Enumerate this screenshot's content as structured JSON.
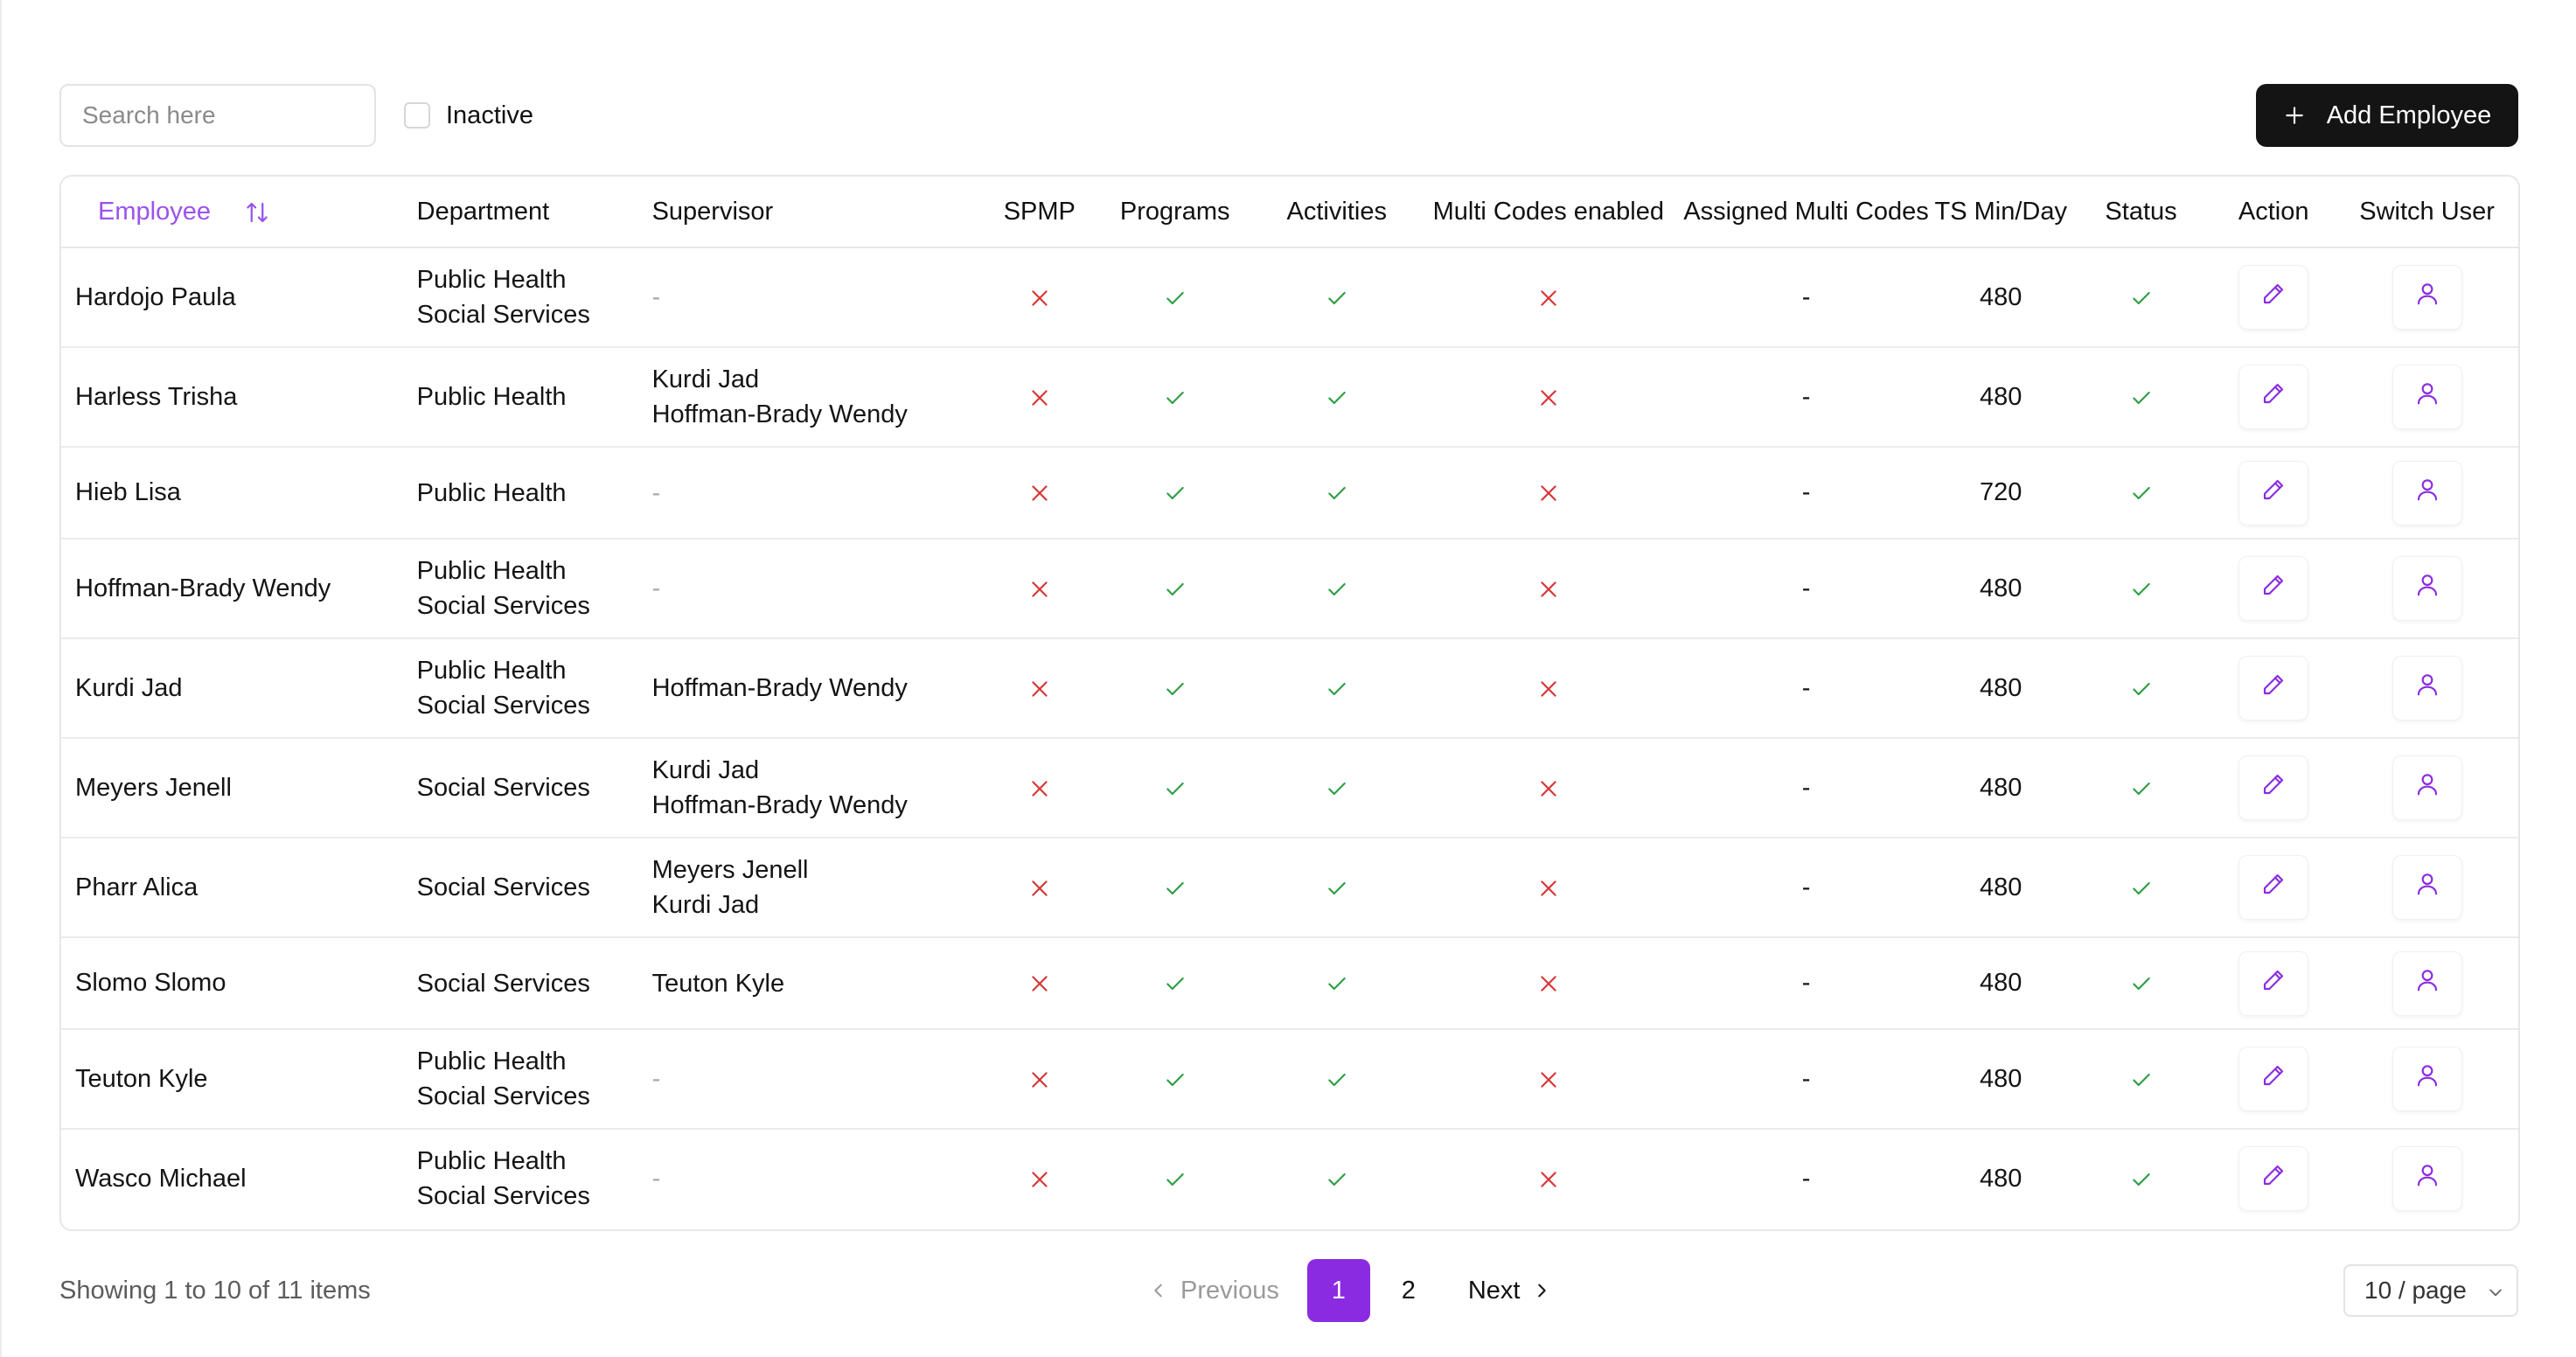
{
  "toolbar": {
    "search_placeholder": "Search here",
    "inactive_label": "Inactive",
    "inactive_checked": false,
    "add_button_label": "Add Employee"
  },
  "table": {
    "columns": [
      "Employee",
      "Department",
      "Supervisor",
      "SPMP",
      "Programs",
      "Activities",
      "Multi Codes enabled",
      "Assigned Multi Codes",
      "TS Min/Day",
      "Status",
      "Action",
      "Switch User"
    ],
    "rows": [
      {
        "employee": "Hardojo Paula",
        "departments": [
          "Public Health",
          "Social Services"
        ],
        "supervisors": [
          "-"
        ],
        "spmp": false,
        "programs": true,
        "activities": true,
        "multi_codes_enabled": false,
        "assigned_multi_codes": "-",
        "ts_min_day": "480",
        "status": true
      },
      {
        "employee": "Harless Trisha",
        "departments": [
          "Public Health"
        ],
        "supervisors": [
          "Kurdi Jad",
          "Hoffman-Brady Wendy"
        ],
        "spmp": false,
        "programs": true,
        "activities": true,
        "multi_codes_enabled": false,
        "assigned_multi_codes": "-",
        "ts_min_day": "480",
        "status": true
      },
      {
        "employee": "Hieb Lisa",
        "departments": [
          "Public Health"
        ],
        "supervisors": [
          "-"
        ],
        "spmp": false,
        "programs": true,
        "activities": true,
        "multi_codes_enabled": false,
        "assigned_multi_codes": "-",
        "ts_min_day": "720",
        "status": true
      },
      {
        "employee": "Hoffman-Brady Wendy",
        "departments": [
          "Public Health",
          "Social Services"
        ],
        "supervisors": [
          "-"
        ],
        "spmp": false,
        "programs": true,
        "activities": true,
        "multi_codes_enabled": false,
        "assigned_multi_codes": "-",
        "ts_min_day": "480",
        "status": true
      },
      {
        "employee": "Kurdi Jad",
        "departments": [
          "Public Health",
          "Social Services"
        ],
        "supervisors": [
          "Hoffman-Brady Wendy"
        ],
        "spmp": false,
        "programs": true,
        "activities": true,
        "multi_codes_enabled": false,
        "assigned_multi_codes": "-",
        "ts_min_day": "480",
        "status": true
      },
      {
        "employee": "Meyers Jenell",
        "departments": [
          "Social Services"
        ],
        "supervisors": [
          "Kurdi Jad",
          "Hoffman-Brady Wendy"
        ],
        "spmp": false,
        "programs": true,
        "activities": true,
        "multi_codes_enabled": false,
        "assigned_multi_codes": "-",
        "ts_min_day": "480",
        "status": true
      },
      {
        "employee": "Pharr Alica",
        "departments": [
          "Social Services"
        ],
        "supervisors": [
          "Meyers Jenell",
          "Kurdi Jad"
        ],
        "spmp": false,
        "programs": true,
        "activities": true,
        "multi_codes_enabled": false,
        "assigned_multi_codes": "-",
        "ts_min_day": "480",
        "status": true
      },
      {
        "employee": "Slomo Slomo",
        "departments": [
          "Social Services"
        ],
        "supervisors": [
          "Teuton Kyle"
        ],
        "spmp": false,
        "programs": true,
        "activities": true,
        "multi_codes_enabled": false,
        "assigned_multi_codes": "-",
        "ts_min_day": "480",
        "status": true
      },
      {
        "employee": "Teuton Kyle",
        "departments": [
          "Public Health",
          "Social Services"
        ],
        "supervisors": [
          "-"
        ],
        "spmp": false,
        "programs": true,
        "activities": true,
        "multi_codes_enabled": false,
        "assigned_multi_codes": "-",
        "ts_min_day": "480",
        "status": true
      },
      {
        "employee": "Wasco Michael",
        "departments": [
          "Public Health",
          "Social Services"
        ],
        "supervisors": [
          "-"
        ],
        "spmp": false,
        "programs": true,
        "activities": true,
        "multi_codes_enabled": false,
        "assigned_multi_codes": "-",
        "ts_min_day": "480",
        "status": true
      }
    ]
  },
  "footer": {
    "showing_text": "Showing 1 to 10 of 11 items",
    "previous_label": "Previous",
    "pages": [
      "1",
      "2"
    ],
    "active_page": "1",
    "next_label": "Next",
    "page_size_label": "10 / page"
  },
  "colors": {
    "accent": "#8a2be2",
    "check": "#2f9e44",
    "cross": "#d93636",
    "button_dark": "#141414"
  },
  "icons": {
    "sort": "sort-arrows-icon",
    "check": "check-icon",
    "cross": "x-icon",
    "edit": "pencil-icon",
    "switch_user": "user-icon",
    "add": "plus-icon"
  }
}
